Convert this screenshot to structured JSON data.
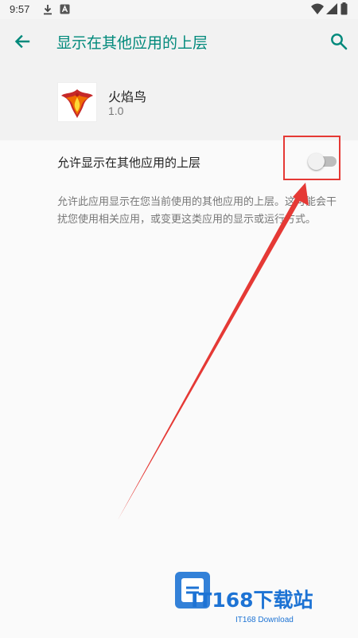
{
  "status_bar": {
    "time": "9:57",
    "icons": [
      "download-icon",
      "a-badge-icon",
      "wifi-icon",
      "signal-icon",
      "battery-icon"
    ]
  },
  "app_bar": {
    "title": "显示在其他应用的上层",
    "back_icon": "arrow-back-icon",
    "search_icon": "search-icon",
    "accent_color": "#00897b"
  },
  "app_info": {
    "name": "火焰鸟",
    "version": "1.0",
    "icon": "phoenix-app-icon"
  },
  "setting": {
    "label": "允许显示在其他应用的上层",
    "toggle_state": "off",
    "description": "允许此应用显示在您当前使用的其他应用的上层。这可能会干扰您使用相关应用，或变更这类应用的显示或运行方式。"
  },
  "annotation": {
    "color": "#e53935"
  },
  "watermark": {
    "brand": "IT168下载站",
    "subtitle": "IT168 Download",
    "color": "#1d73d4"
  }
}
